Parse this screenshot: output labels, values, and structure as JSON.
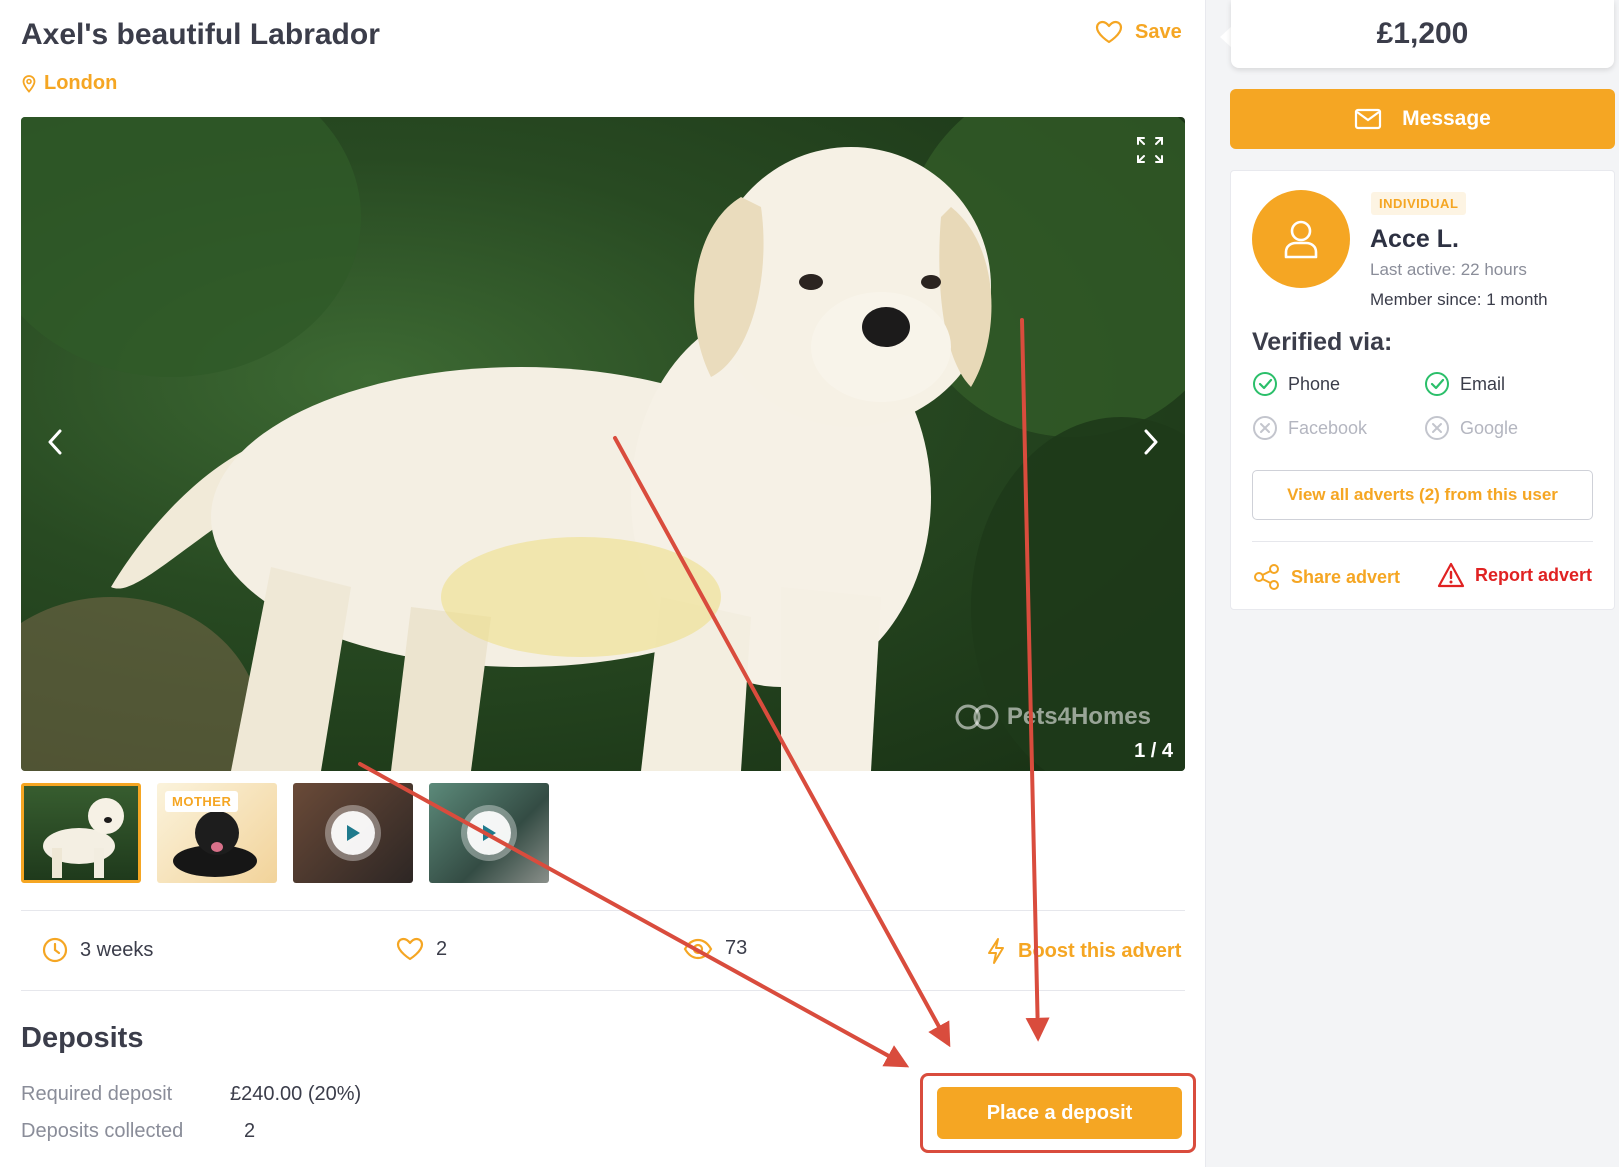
{
  "listing": {
    "title": "Axel's beautiful Labrador",
    "location": "London",
    "save_label": "Save"
  },
  "gallery": {
    "counter": "1 / 4",
    "watermark": "Pets4Homes",
    "thumbnails": [
      {
        "kind": "image",
        "active": true
      },
      {
        "kind": "image",
        "badge": "MOTHER"
      },
      {
        "kind": "video"
      },
      {
        "kind": "video"
      }
    ]
  },
  "stats": {
    "age": "3 weeks",
    "likes": "2",
    "views": "73",
    "boost_label": "Boost this advert"
  },
  "deposits": {
    "title": "Deposits",
    "required_label": "Required deposit",
    "required_value": "£240.00 (20%)",
    "collected_label": "Deposits collected",
    "collected_value": "2",
    "button_label": "Place a deposit"
  },
  "sidebar": {
    "price": "£1,200",
    "message_label": "Message",
    "seller": {
      "type": "INDIVIDUAL",
      "name": "Acce L.",
      "last_active": "Last active: 22 hours",
      "member_since": "Member since: 1 month"
    },
    "verified": {
      "title": "Verified via:",
      "items": [
        {
          "label": "Phone",
          "verified": true
        },
        {
          "label": "Email",
          "verified": true
        },
        {
          "label": "Facebook",
          "verified": false
        },
        {
          "label": "Google",
          "verified": false
        }
      ]
    },
    "view_adverts_label": "View all adverts (2) from this user",
    "share_label": "Share advert",
    "report_label": "Report advert"
  },
  "colors": {
    "accent": "#f5a623",
    "danger": "#e02222",
    "annotation": "#d94c3d"
  }
}
